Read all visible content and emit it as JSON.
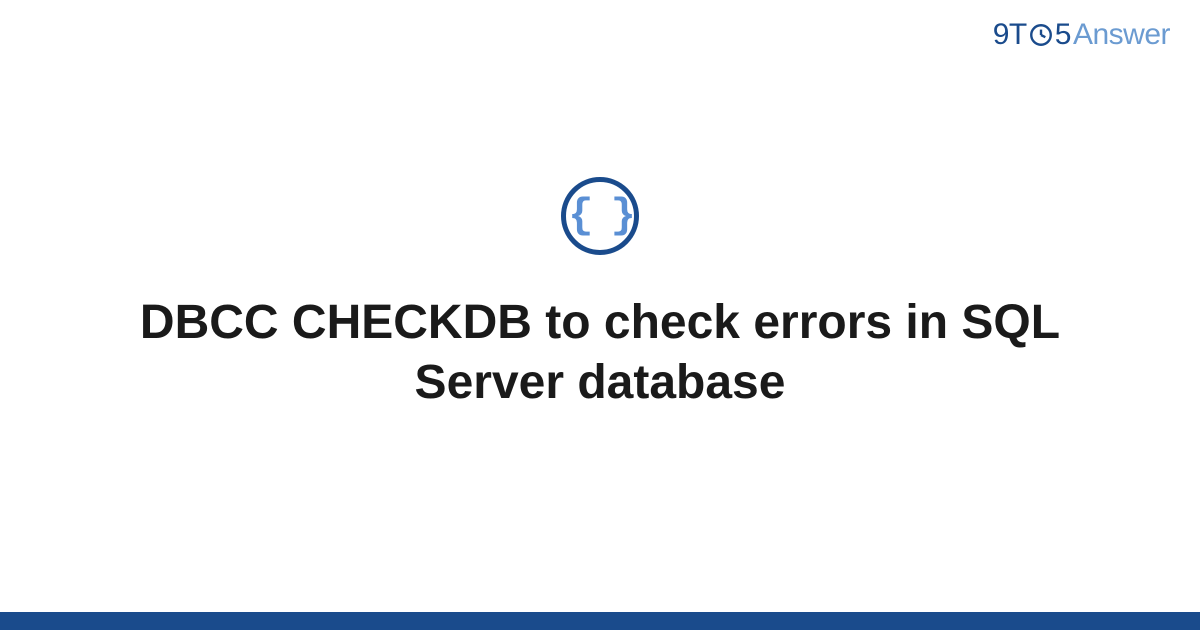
{
  "header": {
    "logo_prefix": "9T",
    "logo_middle": "5",
    "logo_suffix": "Answer"
  },
  "main": {
    "icon_braces": "{ }",
    "title": "DBCC CHECKDB to check errors in SQL Server database"
  },
  "colors": {
    "brand_primary": "#1a4b8c",
    "brand_secondary": "#6b9bd1",
    "icon_accent": "#5a8fd4"
  }
}
